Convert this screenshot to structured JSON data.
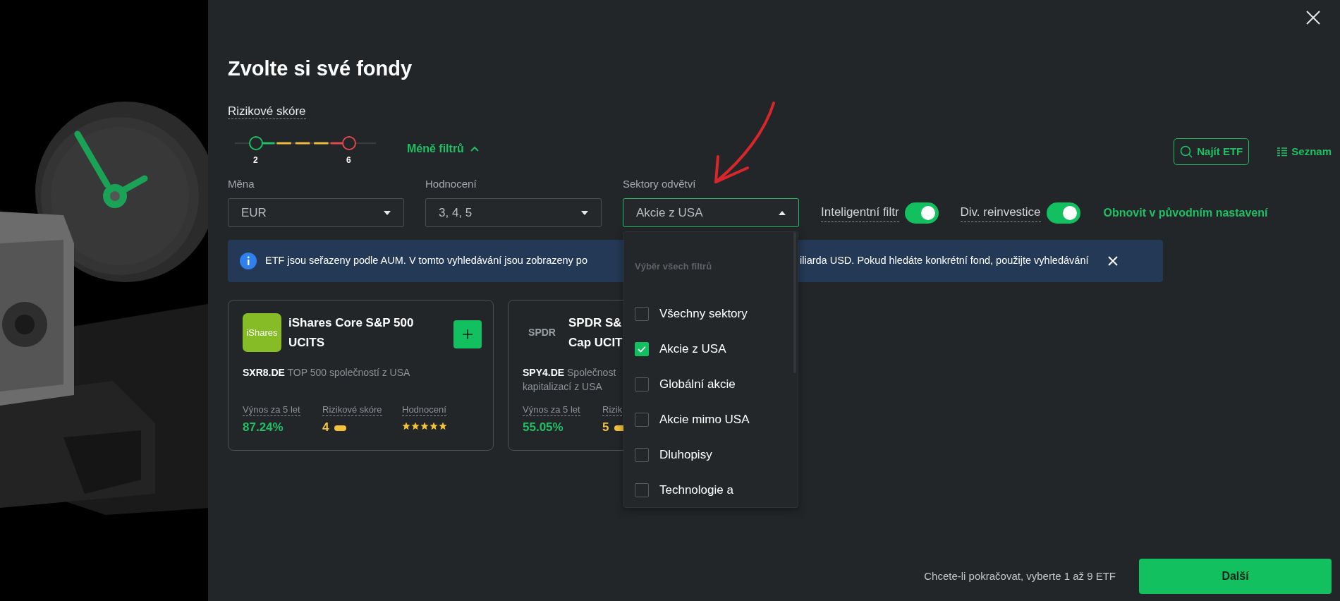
{
  "title": "Zvolte si své fondy",
  "risk_filter": {
    "label": "Rizikové skóre",
    "handles": [
      {
        "value": "2",
        "level": 0.15
      },
      {
        "value": "6",
        "level": 0.81
      }
    ]
  },
  "filter_toggle": {
    "label": "Méně filtrů",
    "expanded": true
  },
  "tools": [
    {
      "label": "Najít ETF",
      "kind": "search"
    },
    {
      "label": "Seznam",
      "kind": "list"
    }
  ],
  "filters": [
    {
      "label": "Měna",
      "value": "EUR",
      "open": false
    },
    {
      "label": "Hodnocení",
      "value": "3, 4, 5",
      "open": false
    },
    {
      "label": "Sektory odvětví",
      "value": "Akcie z USA",
      "open": true
    }
  ],
  "switches": [
    {
      "label": "Inteligentní filtr",
      "on": true
    },
    {
      "label": "Div. reinvestice",
      "on": true
    }
  ],
  "reset_link": "Obnovit v původním nastavení",
  "notice": {
    "text_start": "ETF jsou seřazeny podle AUM. V tomto vyhledávání jsou zobrazeny po",
    "text_end": "iliarda USD. Pokud hledáte konkrétní fond, použijte vyhledávání"
  },
  "dropdown": {
    "heading": "Výběr všech filtrů",
    "options": [
      {
        "label": "Všechny sektory",
        "checked": false
      },
      {
        "label": "Akcie z USA",
        "checked": true
      },
      {
        "label": "Globální akcie",
        "checked": false
      },
      {
        "label": "Akcie mimo USA",
        "checked": false
      },
      {
        "label": "Dluhopisy",
        "checked": false
      },
      {
        "label": "Technologie a",
        "checked": false
      }
    ]
  },
  "funds": [
    {
      "logo": {
        "text": "iShares",
        "kind": "tile"
      },
      "name_lines": [
        "iShares Core S&P 500 UCITS"
      ],
      "description_lines": [
        "**SXR8.DE** TOP 500 společností z USA"
      ],
      "addable": true,
      "stats": [
        {
          "kind": "return",
          "label": "Výnos za 5 let",
          "value": "87.24%"
        },
        {
          "kind": "risk",
          "label": "Rizikové skóre",
          "value": "4"
        },
        {
          "kind": "rating",
          "label": "Hodnocení",
          "stars": 5
        }
      ]
    },
    {
      "logo": {
        "text": "SPDR",
        "kind": "plain"
      },
      "name_lines": [
        "SPDR S&",
        "Cap UCIT"
      ],
      "description_lines": [
        "**SPY4.DE** Společnost",
        "kapitalizací z USA"
      ],
      "addable": false,
      "stats": [
        {
          "kind": "return",
          "label": "Výnos za 5 let",
          "value": "55.05%"
        },
        {
          "kind": "risk",
          "label": "Rizik",
          "value": "5"
        }
      ]
    }
  ],
  "footer": {
    "hint": "Chcete-li pokračovat, vyberte 1 až 9 ETF",
    "next_button": "Další"
  }
}
